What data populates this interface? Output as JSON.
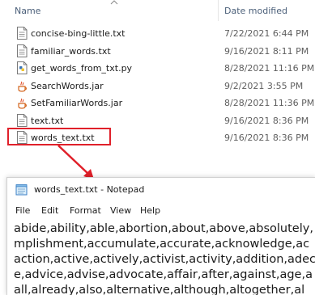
{
  "explorer": {
    "columns": {
      "name": "Name",
      "date_modified": "Date modified"
    },
    "files": [
      {
        "name": "concise-bing-little.txt",
        "date": "7/22/2021 6:44 PM",
        "icon": "text-file-icon"
      },
      {
        "name": "familiar_words.txt",
        "date": "9/16/2021 8:11 PM",
        "icon": "text-file-icon"
      },
      {
        "name": "get_words_from_txt.py",
        "date": "8/28/2021 11:16 PM",
        "icon": "python-file-icon"
      },
      {
        "name": "SearchWords.jar",
        "date": "9/2/2021 3:55 PM",
        "icon": "java-jar-icon"
      },
      {
        "name": "SetFamiliarWords.jar",
        "date": "8/28/2021 11:36 PM",
        "icon": "java-jar-icon"
      },
      {
        "name": "text.txt",
        "date": "9/16/2021 8:36 PM",
        "icon": "text-file-icon"
      },
      {
        "name": "words_text.txt",
        "date": "9/16/2021 8:36 PM",
        "icon": "text-file-icon"
      }
    ],
    "highlight_color": "#e0202a"
  },
  "notepad": {
    "title": "words_text.txt - Notepad",
    "menu": [
      "File",
      "Edit",
      "Format",
      "View",
      "Help"
    ],
    "lines": [
      "abide,ability,able,abortion,about,above,absolutely,",
      "mplishment,accumulate,accurate,acknowledge,ac",
      "action,active,actively,activist,activity,addition,adec",
      "e,advice,advise,advocate,affair,after,against,age,a",
      "all,already,also,alternative,although,altogether,al"
    ]
  }
}
